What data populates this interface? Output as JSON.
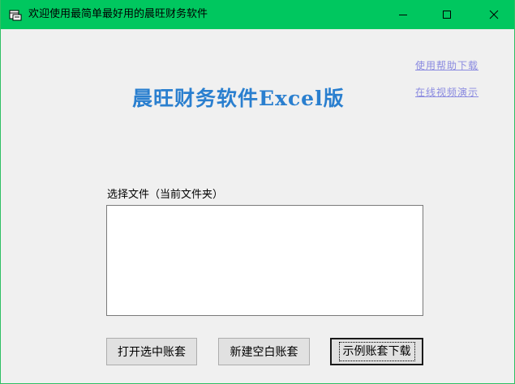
{
  "window": {
    "title": "欢迎使用最简单最好用的晨旺财务软件",
    "controls": {
      "minimize": "minimize-icon",
      "maximize": "maximize-icon",
      "close": "close-icon"
    }
  },
  "colors": {
    "titlebar": "#00c75f",
    "app_title": "#2a7fcf",
    "link": "#8a8ae0",
    "background": "#f0f0f0"
  },
  "links": {
    "help_download": "使用帮助下载",
    "video_demo": "在线视频演示"
  },
  "app_title": "晨旺财务软件Excel版",
  "file_section": {
    "label": "选择文件（当前文件夹）",
    "items": []
  },
  "buttons": {
    "open_selected": "打开选中账套",
    "new_blank": "新建空白账套",
    "sample_download": "示例账套下载"
  }
}
